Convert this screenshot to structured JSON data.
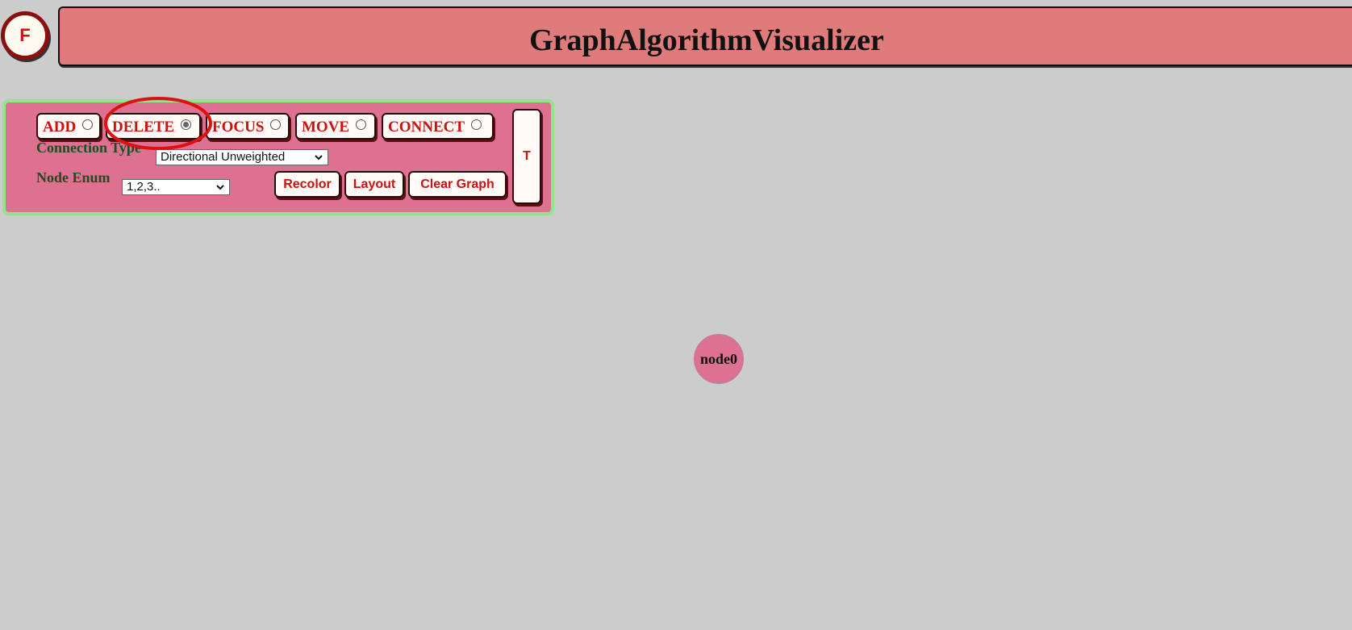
{
  "header": {
    "menu_button_label": "F",
    "title": "GraphAlgorithmVisualizer"
  },
  "controls": {
    "modes": [
      {
        "label": "ADD",
        "selected": false
      },
      {
        "label": "DELETE",
        "selected": true
      },
      {
        "label": "FOCUS",
        "selected": false
      },
      {
        "label": "MOVE",
        "selected": false
      },
      {
        "label": "CONNECT",
        "selected": false
      }
    ],
    "connection_type_label": "Connection Type",
    "connection_type_value": "Directional Unweighted",
    "node_enum_label": "Node Enum",
    "node_enum_value": "1,2,3..",
    "recolor_label": "Recolor",
    "layout_label": "Layout",
    "clear_graph_label": "Clear Graph",
    "toggle_label": "T"
  },
  "graph": {
    "nodes": [
      {
        "label": "node0"
      }
    ]
  },
  "colors": {
    "background": "#cccccc",
    "title_bar": "#e07b7b",
    "panel": "#de7092",
    "panel_border": "#8fe68f",
    "button_text": "#cc1111",
    "label_text": "#1f4d1f",
    "node_fill": "#de7092",
    "highlight": "#dd1111"
  }
}
